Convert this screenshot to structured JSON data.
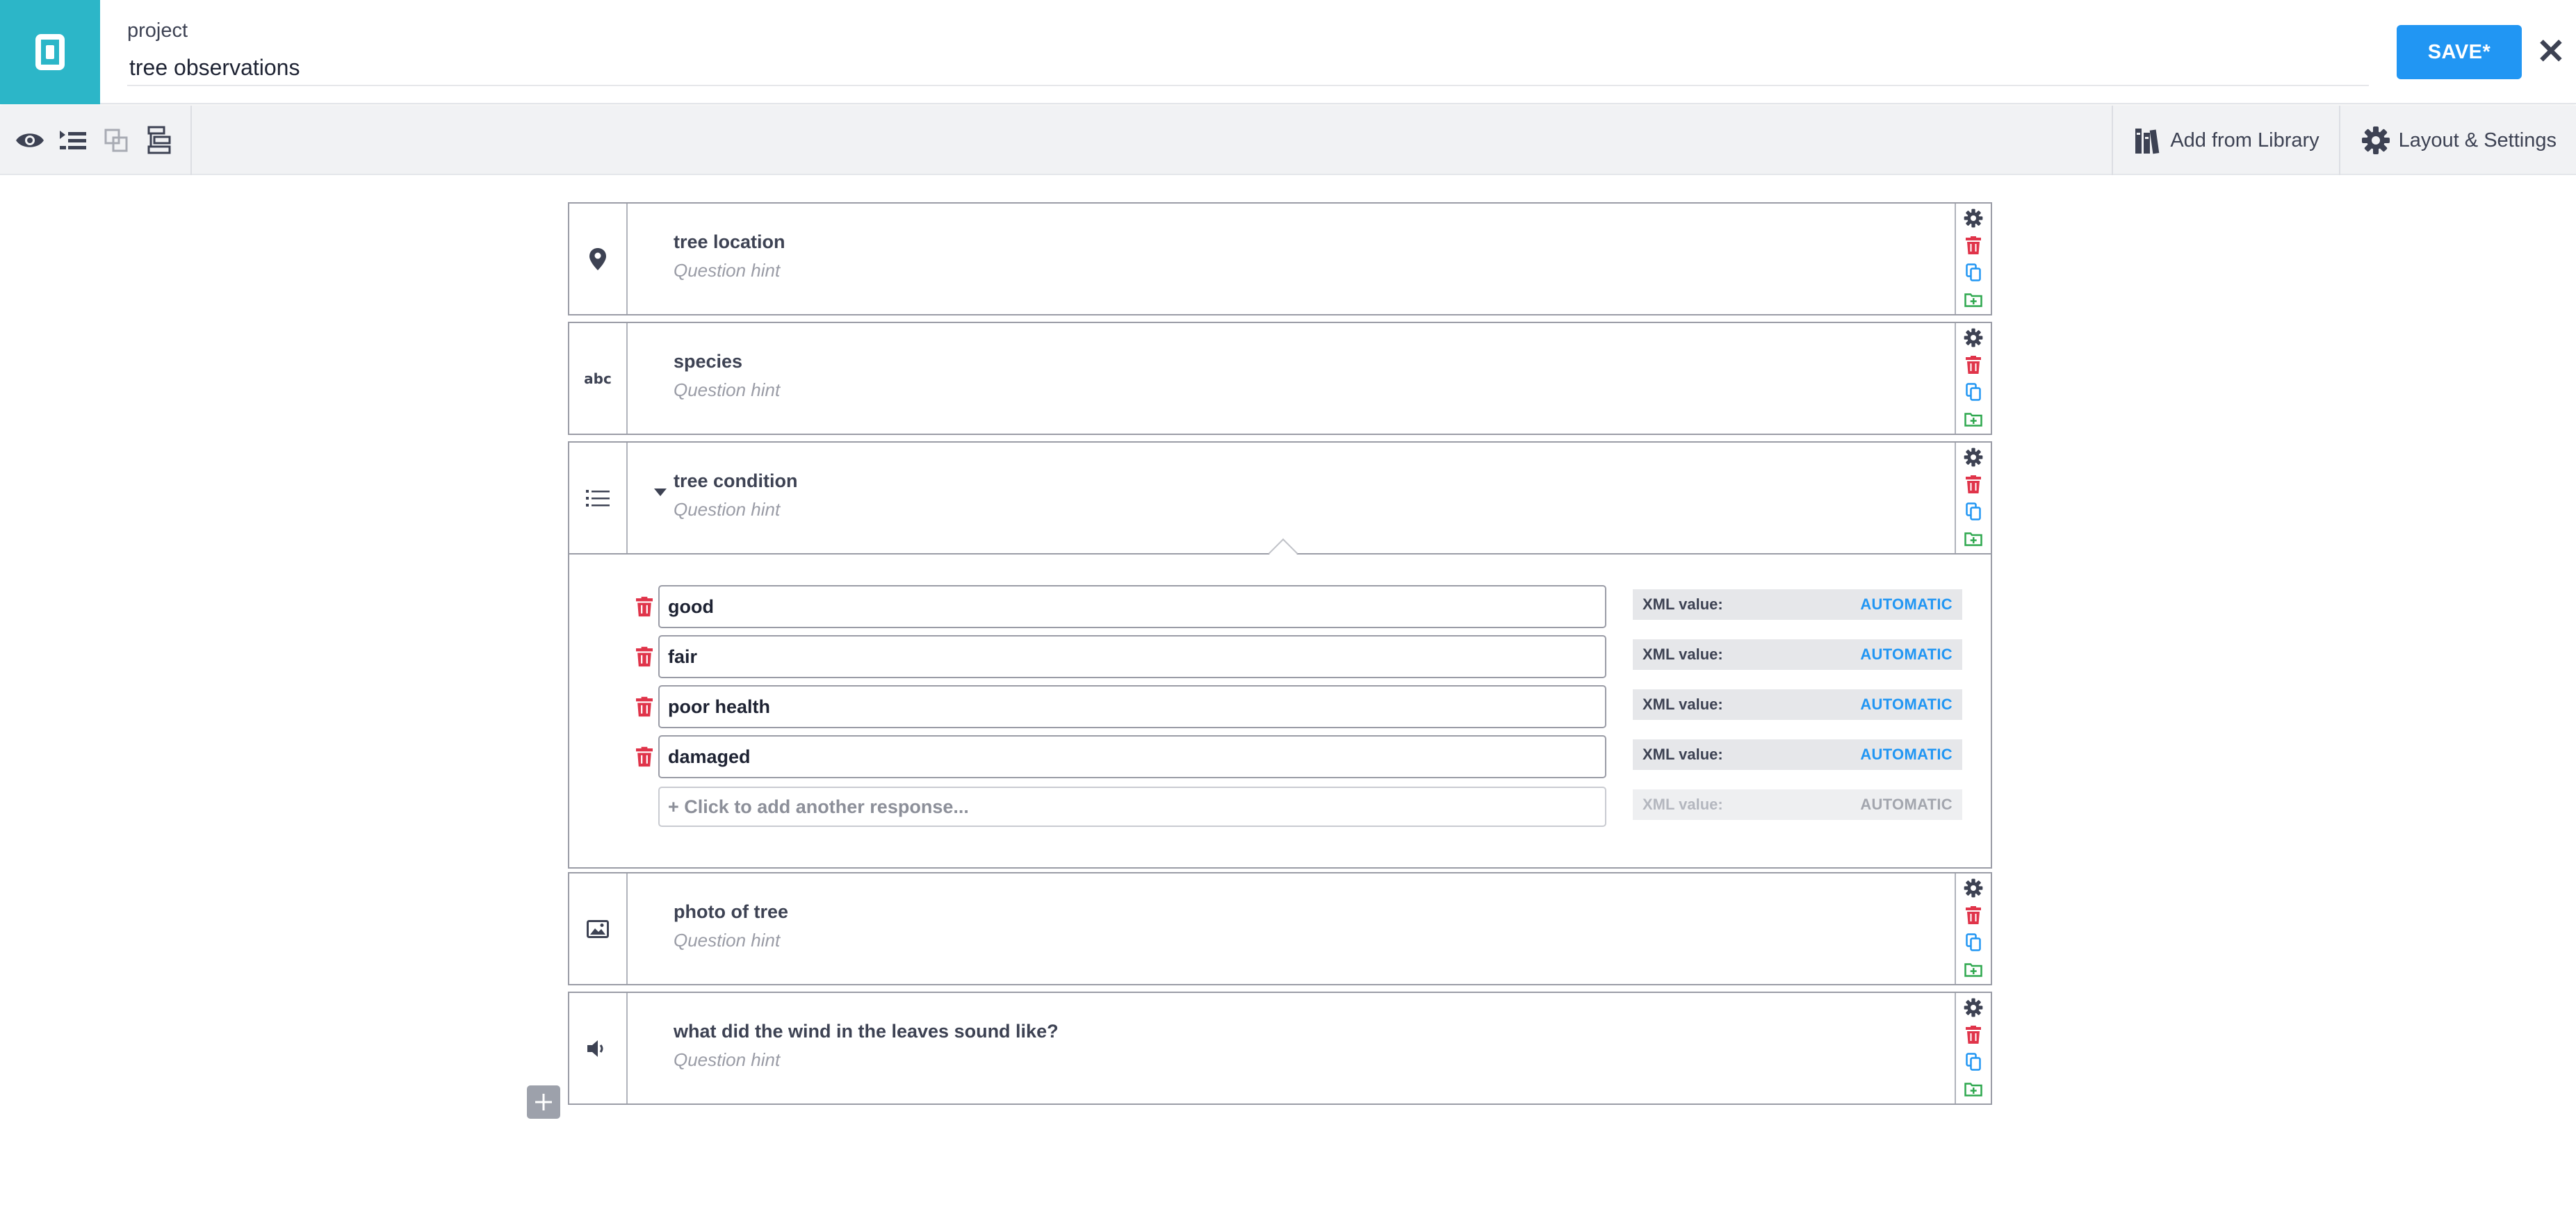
{
  "header": {
    "project_label": "project",
    "project_title": "tree observations",
    "save_label": "SAVE*",
    "close_label": "✕"
  },
  "toolbar": {
    "left_icons": [
      "preview-eye-icon",
      "group-questions-icon",
      "copy-layout-icon",
      "tree-structure-icon"
    ],
    "add_from_library_label": "Add from Library",
    "layout_settings_label": "Layout & Settings"
  },
  "questions": [
    {
      "type_icon": "location-pin-icon",
      "label": "tree location",
      "hint": "Question hint"
    },
    {
      "type_icon": "text-abc-icon",
      "type_text": "abc",
      "label": "species",
      "hint": "Question hint"
    },
    {
      "type_icon": "list-icon",
      "label": "tree condition",
      "hint": "Question hint",
      "expanded": true
    },
    {
      "type_icon": "photo-icon",
      "label": "photo of tree",
      "hint": "Question hint"
    },
    {
      "type_icon": "audio-speaker-icon",
      "label": "what did the wind in the leaves sound like?",
      "hint": "Question hint"
    }
  ],
  "choices": {
    "items": [
      {
        "label": "good",
        "xml_label": "XML value:",
        "xml_value": "AUTOMATIC"
      },
      {
        "label": "fair",
        "xml_label": "XML value:",
        "xml_value": "AUTOMATIC"
      },
      {
        "label": "poor health",
        "xml_label": "XML value:",
        "xml_value": "AUTOMATIC"
      },
      {
        "label": "damaged",
        "xml_label": "XML value:",
        "xml_value": "AUTOMATIC"
      }
    ],
    "add_placeholder": "+ Click to add another response...",
    "add_xml_label": "XML value:",
    "add_xml_value": "AUTOMATIC"
  },
  "colors": {
    "brand": "#2cb6c8",
    "primary": "#2196f3",
    "delete": "#e0344a",
    "duplicate": "#2196f3",
    "add_to_library": "#2fa84f"
  }
}
